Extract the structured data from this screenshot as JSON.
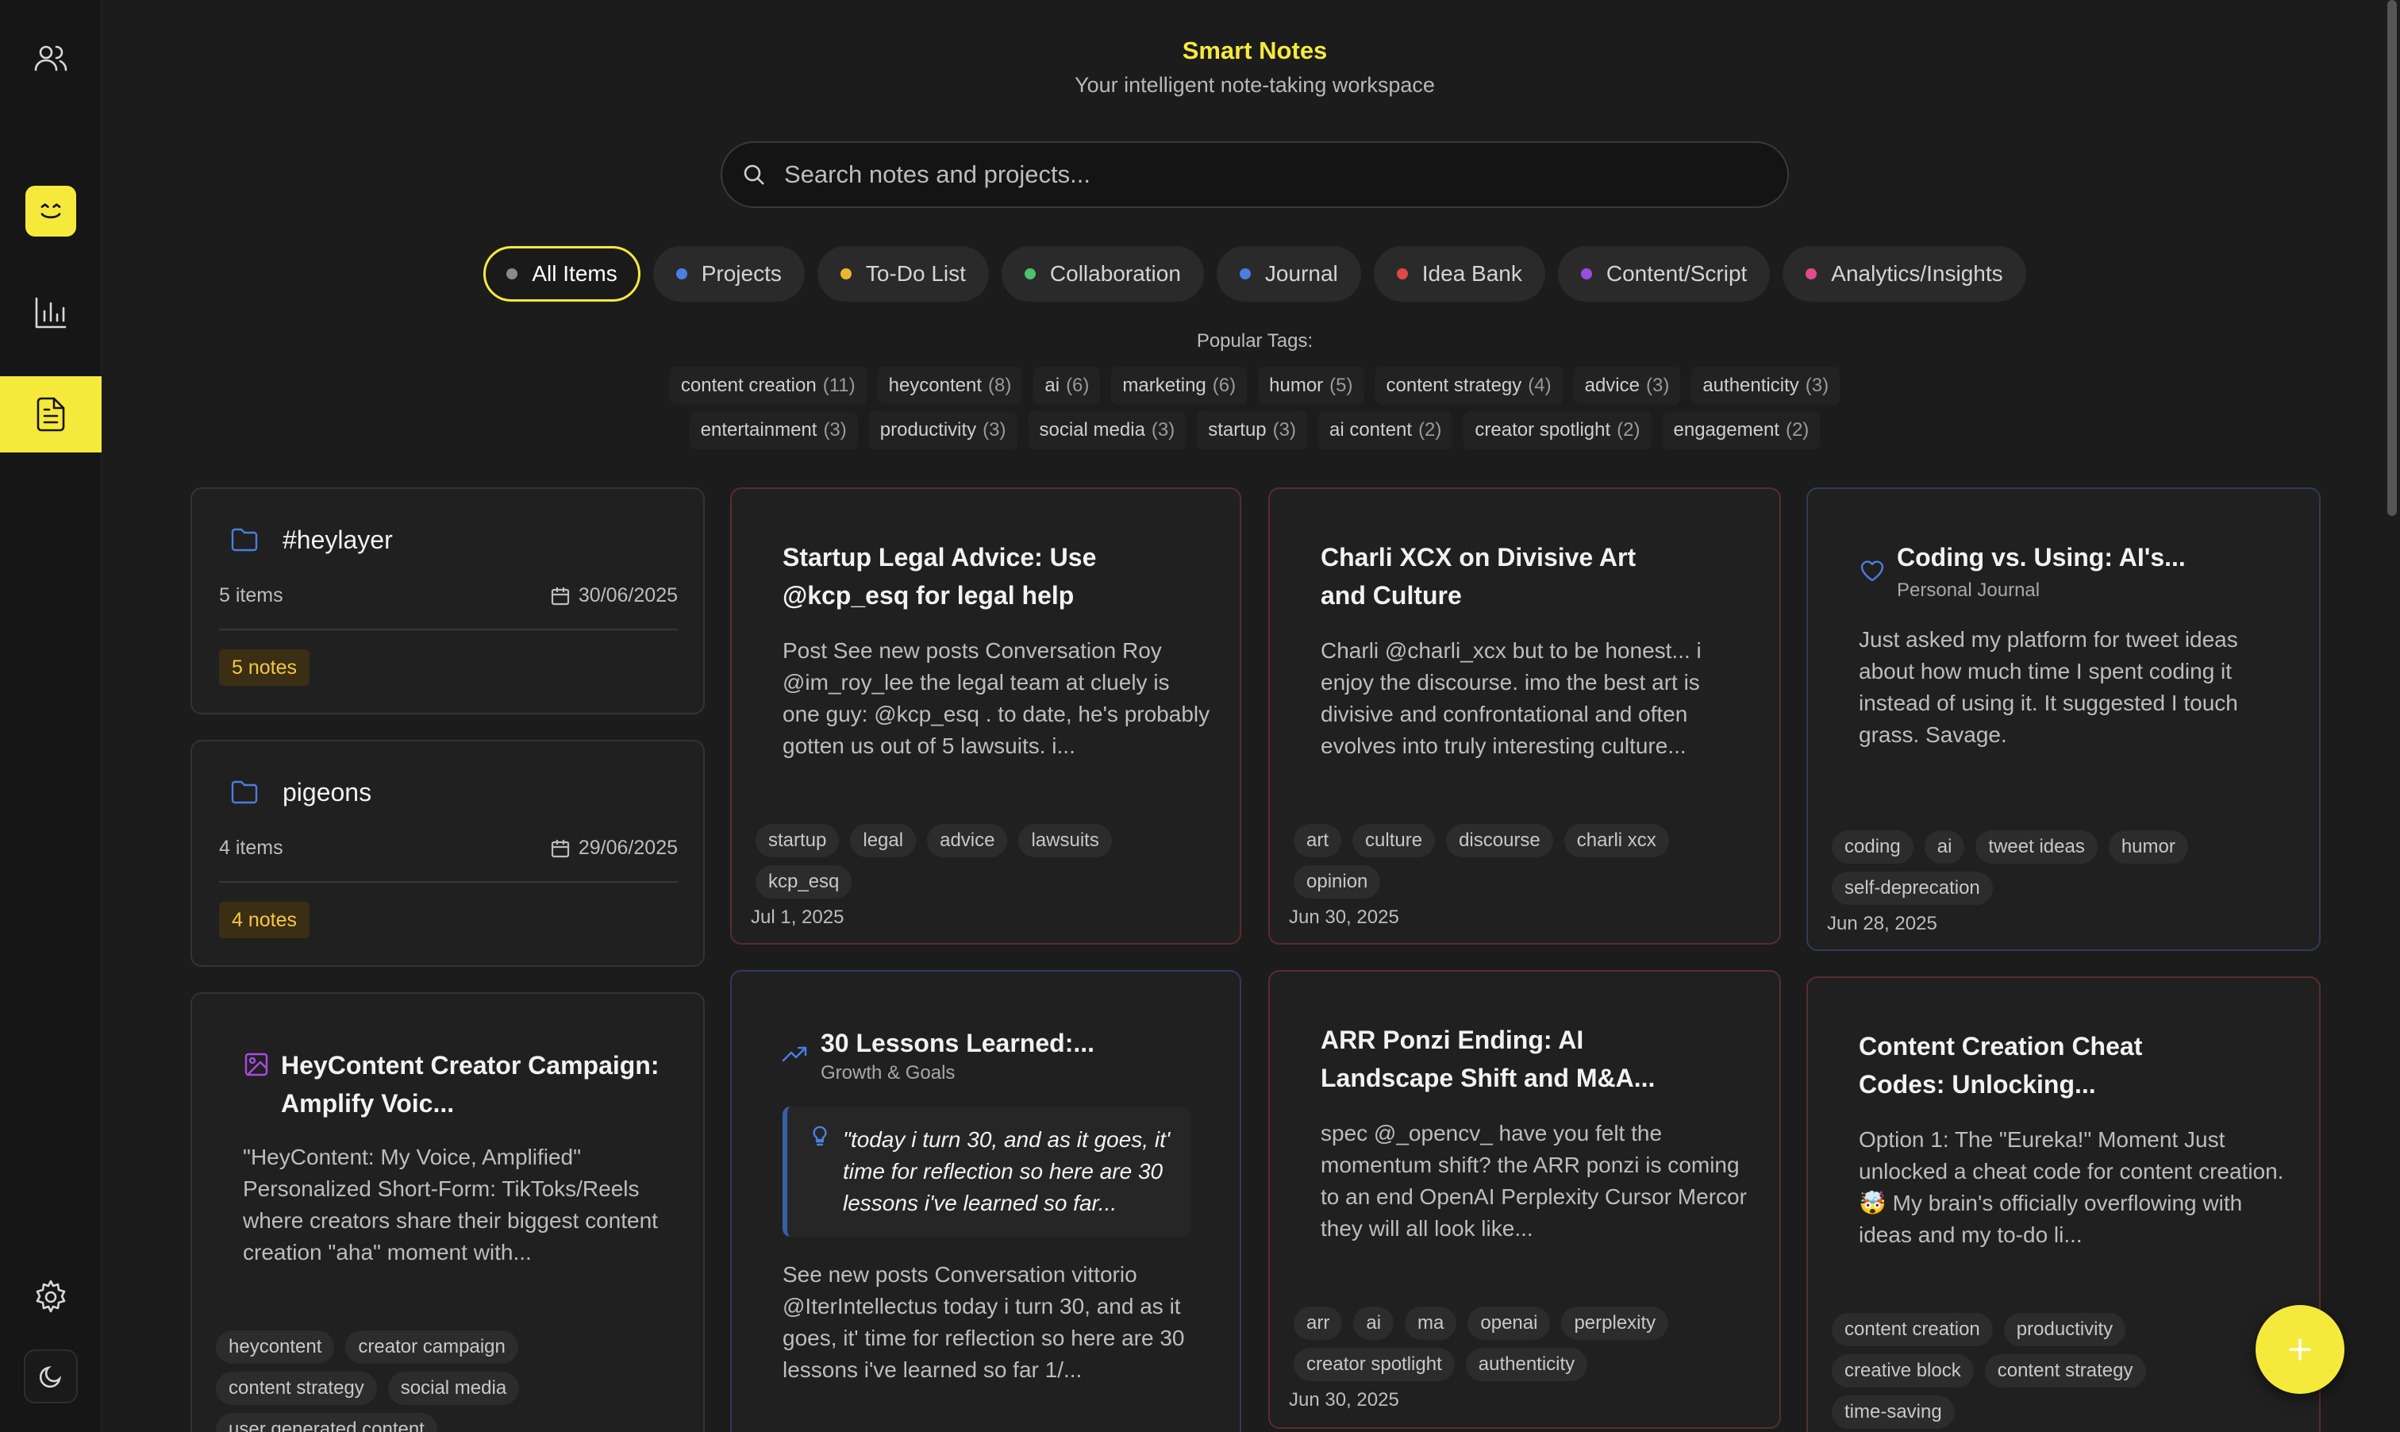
{
  "app": {
    "title": "Smart Notes",
    "subtitle": "Your intelligent note-taking workspace"
  },
  "search": {
    "placeholder": "Search notes and projects..."
  },
  "filters": [
    {
      "label": "All Items",
      "color": "#8a8a8a",
      "active": true
    },
    {
      "label": "Projects",
      "color": "#4a7fe0"
    },
    {
      "label": "To-Do List",
      "color": "#e8b730"
    },
    {
      "label": "Collaboration",
      "color": "#4cc26a"
    },
    {
      "label": "Journal",
      "color": "#4a7fe0"
    },
    {
      "label": "Idea Bank",
      "color": "#e04848"
    },
    {
      "label": "Content/Script",
      "color": "#9b4ce0"
    },
    {
      "label": "Analytics/Insights",
      "color": "#e04c8c"
    }
  ],
  "popular_tags": {
    "label": "Popular Tags:",
    "row1": [
      {
        "name": "content creation",
        "count": "(11)"
      },
      {
        "name": "heycontent",
        "count": "(8)"
      },
      {
        "name": "ai",
        "count": "(6)"
      },
      {
        "name": "marketing",
        "count": "(6)"
      },
      {
        "name": "humor",
        "count": "(5)"
      },
      {
        "name": "content strategy",
        "count": "(4)"
      },
      {
        "name": "advice",
        "count": "(3)"
      },
      {
        "name": "authenticity",
        "count": "(3)"
      }
    ],
    "row2": [
      {
        "name": "entertainment",
        "count": "(3)"
      },
      {
        "name": "productivity",
        "count": "(3)"
      },
      {
        "name": "social media",
        "count": "(3)"
      },
      {
        "name": "startup",
        "count": "(3)"
      },
      {
        "name": "ai content",
        "count": "(2)"
      },
      {
        "name": "creator spotlight",
        "count": "(2)"
      },
      {
        "name": "engagement",
        "count": "(2)"
      }
    ]
  },
  "folders": [
    {
      "name": "#heylayer",
      "items": "5 items",
      "date": "30/06/2025",
      "notes": "5 notes"
    },
    {
      "name": "pigeons",
      "items": "4 items",
      "date": "29/06/2025",
      "notes": "4 notes"
    }
  ],
  "notes": {
    "legal": {
      "title": "Startup Legal Advice: Use @kcp_esq for legal help",
      "body": "Post See new posts Conversation Roy @im_roy_lee the legal team at cluely is one guy: @kcp_esq . to date, he's probably gotten us out of 5 lawsuits. i...",
      "tags": [
        "startup",
        "legal",
        "advice",
        "lawsuits",
        "kcp_esq"
      ],
      "date": "Jul 1, 2025"
    },
    "charli": {
      "title": "Charli XCX on Divisive Art and Culture",
      "body": "Charli @charli_xcx but to be honest... i enjoy the discourse. imo the best art is divisive and confrontational and often evolves into truly interesting culture...",
      "tags": [
        "art",
        "culture",
        "discourse",
        "charli xcx",
        "opinion"
      ],
      "date": "Jun 30, 2025"
    },
    "coding": {
      "title": "Coding vs. Using: AI's...",
      "category": "Personal Journal",
      "body": "Just asked my platform for tweet ideas about how much time I spent coding it instead of using it. It suggested I touch grass. Savage.",
      "tags": [
        "coding",
        "ai",
        "tweet ideas",
        "humor",
        "self-deprecation"
      ],
      "date": "Jun 28, 2025"
    },
    "heycontent": {
      "title": "HeyContent Creator Campaign: Amplify Voic...",
      "body": "\"HeyContent: My Voice, Amplified\" Personalized Short-Form: TikToks/Reels where creators share their biggest content creation \"aha\" moment with...",
      "tags": [
        "heycontent",
        "creator campaign",
        "content strategy",
        "social media",
        "user generated content"
      ]
    },
    "lessons": {
      "title": "30 Lessons Learned:...",
      "category": "Growth & Goals",
      "quote": "\"today i turn 30, and as it goes, it' time for reflection so here are 30 lessons i've learned so far...",
      "body": "See new posts Conversation vittorio @IterIntellectus today i turn 30, and as it goes, it' time for reflection so here are 30 lessons i've learned so far 1/..."
    },
    "arr": {
      "title": "ARR Ponzi Ending: AI Landscape Shift and M&A...",
      "body": "spec @_opencv_ have you felt the momentum shift? the ARR ponzi is coming to an end OpenAI Perplexity Cursor Mercor they will all look like...",
      "tags": [
        "arr",
        "ai",
        "ma",
        "openai",
        "perplexity",
        "creator spotlight",
        "authenticity"
      ],
      "date": "Jun 30, 2025"
    },
    "cheat": {
      "title": "Content Creation Cheat Codes: Unlocking...",
      "body": "Option 1: The \"Eureka!\" Moment   Just unlocked a cheat code for content creation. 🤯 My brain's officially overflowing with ideas and my to-do li...",
      "tags": [
        "content creation",
        "productivity",
        "creative block",
        "content strategy",
        "time-saving"
      ]
    }
  },
  "colors": {
    "accent": "#f5ea3c",
    "background": "#1c1c1c",
    "card": "#202020"
  }
}
